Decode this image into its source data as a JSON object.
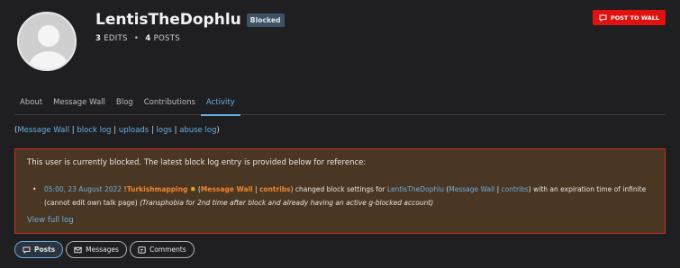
{
  "profile": {
    "username": "LentisTheDophlu",
    "status_badge": "Blocked",
    "edits_count": "3",
    "edits_label": "EDITS",
    "separator": "•",
    "posts_count": "4",
    "posts_label": "POSTS",
    "avatar_icon": "default-user-avatar"
  },
  "actions": {
    "post_to_wall": "POST TO WALL",
    "post_icon": "speech-bubble-icon",
    "accent": "#e0120f"
  },
  "tabs": [
    {
      "label": "About"
    },
    {
      "label": "Message Wall"
    },
    {
      "label": "Blog"
    },
    {
      "label": "Contributions"
    },
    {
      "label": "Activity",
      "active": true
    }
  ],
  "log_links": {
    "open": "(",
    "items": [
      "Message Wall",
      "block log",
      "uploads",
      "logs",
      "abuse log"
    ],
    "sep": " | ",
    "close": ")"
  },
  "block_notice": {
    "intro": "This user is currently blocked. The latest block log entry is provided below for reference:",
    "timestamp": "05:00, 23 August 2022",
    "admin": "!Turkishmapping",
    "admin_icon": "gear-icon",
    "admin_links_open": " (",
    "admin_wall": "Message Wall",
    "link_sep": " | ",
    "admin_contribs": "contribs",
    "admin_links_close": ")",
    "action_text": " changed block settings for ",
    "target": "LentisTheDophlu",
    "target_links_open": " (",
    "target_wall": "Message Wall",
    "target_contribs": "contribs",
    "target_links_close": ")",
    "expiry_text": " with an expiration time of infinite (cannot edit own talk page) ",
    "reason": "(Transphobia for 2nd time after block and already having an active g-blocked account)",
    "view_full_log": "View full log",
    "border_color": "#d22b23",
    "background_color": "#4a3723"
  },
  "filters": [
    {
      "label": "Posts",
      "icon": "speech-bubble-icon",
      "active": true
    },
    {
      "label": "Messages",
      "icon": "envelope-icon",
      "active": false
    },
    {
      "label": "Comments",
      "icon": "comment-icon",
      "active": false
    }
  ],
  "colors": {
    "background": "#1f1f21",
    "link": "#6aaee0",
    "badge": "#3d5266"
  }
}
